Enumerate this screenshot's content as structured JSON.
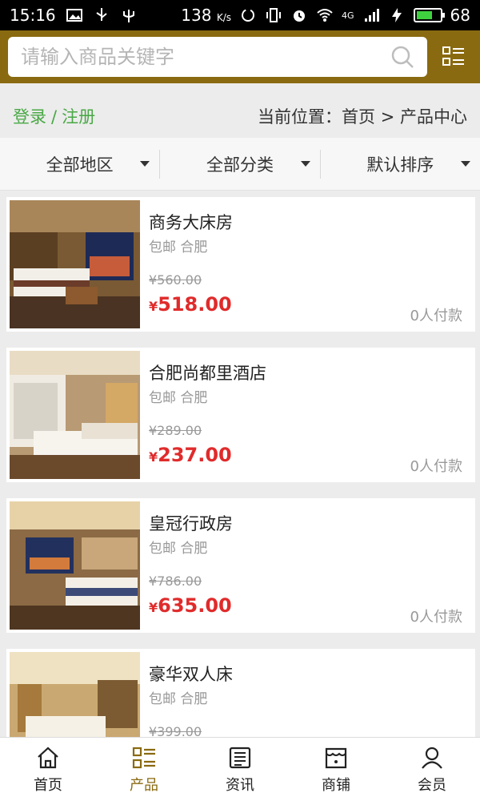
{
  "status_bar": {
    "time": "15:16",
    "network_speed": "138",
    "speed_unit": "K/s",
    "battery": "68",
    "signal": "4G"
  },
  "search": {
    "placeholder": "请输入商品关键字"
  },
  "user": {
    "login": "登录",
    "separator": "/",
    "register": "注册"
  },
  "breadcrumb": {
    "text": "当前位置：首页 > 产品中心"
  },
  "filters": {
    "region": "全部地区",
    "category": "全部分类",
    "sort": "默认排序"
  },
  "products": [
    {
      "name": "商务大床房",
      "tags": "包邮 合肥",
      "old_price": "¥560.00",
      "currency": "¥",
      "price": "518.00",
      "sold": "0人付款"
    },
    {
      "name": "合肥尚都里酒店",
      "tags": "包邮 合肥",
      "old_price": "¥289.00",
      "currency": "¥",
      "price": "237.00",
      "sold": "0人付款"
    },
    {
      "name": "皇冠行政房",
      "tags": "包邮 合肥",
      "old_price": "¥786.00",
      "currency": "¥",
      "price": "635.00",
      "sold": "0人付款"
    },
    {
      "name": "豪华双人床",
      "tags": "包邮 合肥",
      "old_price": "¥399.00",
      "currency": "¥",
      "price": "",
      "sold": ""
    }
  ],
  "nav": {
    "home": "首页",
    "products": "产品",
    "news": "资讯",
    "shops": "商铺",
    "member": "会员"
  },
  "colors": {
    "header": "#8a6a10",
    "price": "#e02b2b",
    "login": "#49a845"
  }
}
